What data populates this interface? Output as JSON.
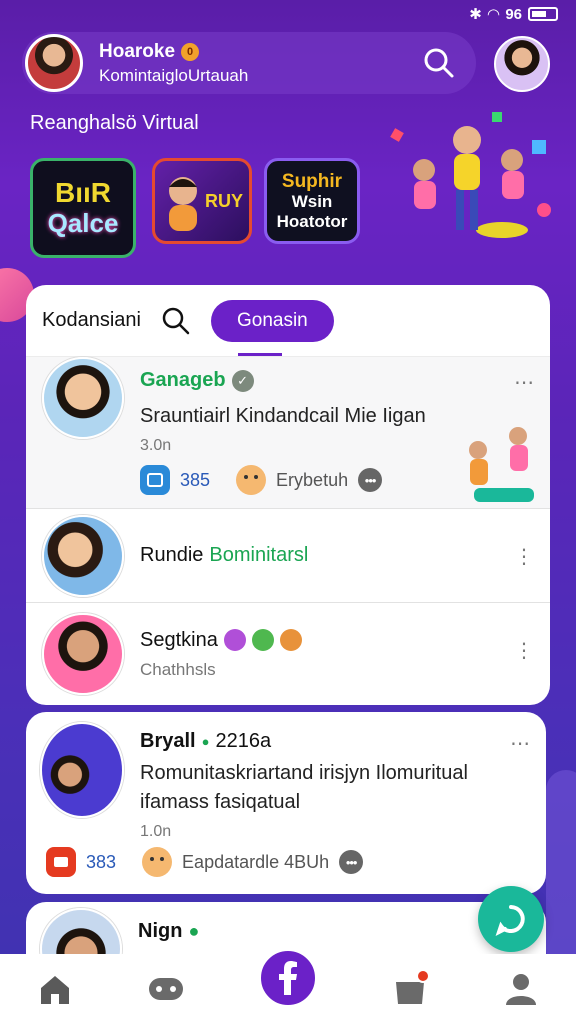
{
  "status_bar": {
    "signal_text": "96"
  },
  "header": {
    "name": "Hoaroke",
    "badge": "0",
    "subtitle": "KomintaigloUrtauah"
  },
  "section_title": "Reanghalsö Virtual",
  "tiles": [
    {
      "line1": "BııR",
      "line2": "Qalce"
    },
    {
      "line1": "RUY"
    },
    {
      "line1": "Suphir",
      "line2": "Wsin",
      "line3": "Hoatotor"
    }
  ],
  "tabs": {
    "label": "Kodansiani",
    "active_pill": "Gonasin"
  },
  "feed": [
    {
      "name": "Ganageb",
      "text": "Srauntiairl Kindandcail Mie Iigan",
      "time": "3.0n",
      "count": "385",
      "meta_label": "Erybetuh"
    },
    {
      "name_plain": "Rundie",
      "name_green": "Bominitarsl"
    },
    {
      "name": "Segtkina",
      "sub": "Chathhsls"
    }
  ],
  "card2": {
    "name": "Bryall",
    "name_suffix": "2216a",
    "text_line1": "Romunitaskriartand irisjyn Ilomuritual",
    "text_line2": "ifamass fasiqatual",
    "time": "1.0n",
    "count": "383",
    "meta_label": "Eapdatardle 4BUh"
  },
  "card3": {
    "name": "Nign"
  },
  "colors": {
    "accent": "#6b21c8",
    "verified_green": "#1aa552",
    "fab": "#1ab89a"
  }
}
